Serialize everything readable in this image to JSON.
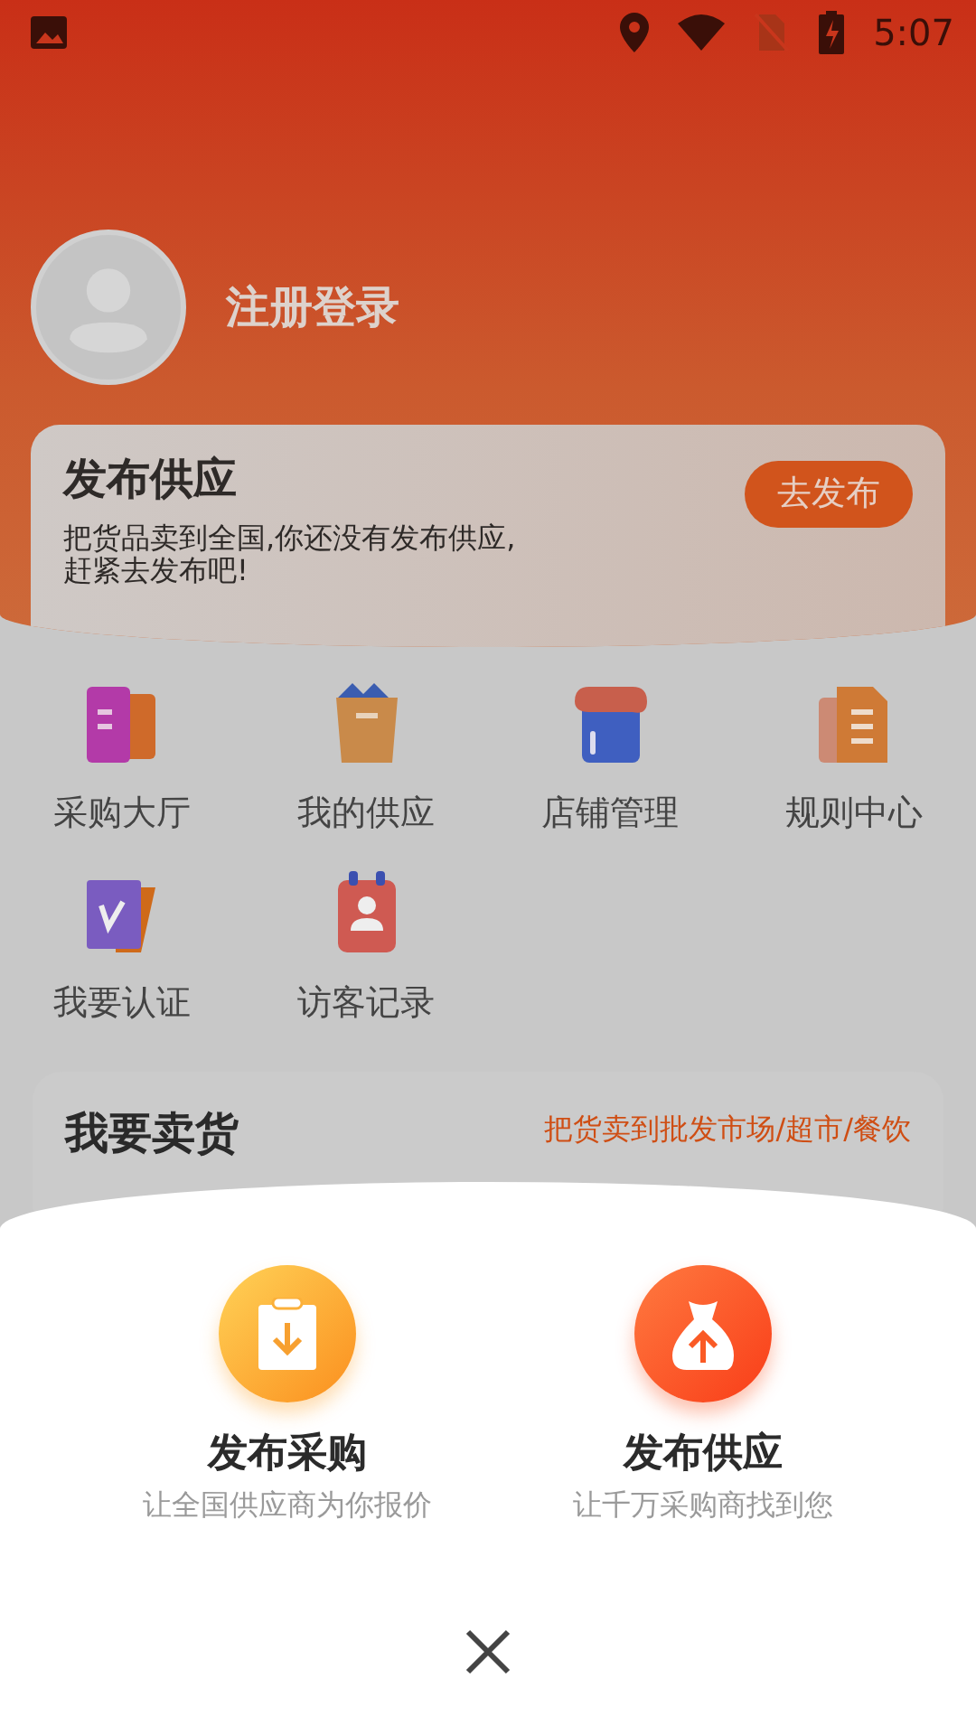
{
  "status_bar": {
    "time": "5:07"
  },
  "profile": {
    "login_label": "注册登录"
  },
  "publish_card": {
    "title": "发布供应",
    "description": "把货品卖到全国,你还没有发布供应,\n赶紧去发布吧!",
    "button": "去发布"
  },
  "menu": [
    {
      "kind": "hall",
      "label": "采购大厅"
    },
    {
      "kind": "supply",
      "label": "我的供应"
    },
    {
      "kind": "shop",
      "label": "店铺管理"
    },
    {
      "kind": "rules",
      "label": "规则中心"
    },
    {
      "kind": "verify",
      "label": "我要认证"
    },
    {
      "kind": "visitors",
      "label": "访客记录"
    }
  ],
  "sell_card": {
    "title": "我要卖货",
    "subtitle": "把货卖到批发市场/超市/餐饮"
  },
  "sheet": {
    "options": [
      {
        "kind": "purchase",
        "title": "发布采购",
        "subtitle": "让全国供应商为你报价"
      },
      {
        "kind": "supply",
        "title": "发布供应",
        "subtitle": "让千万采购商找到您"
      }
    ]
  }
}
